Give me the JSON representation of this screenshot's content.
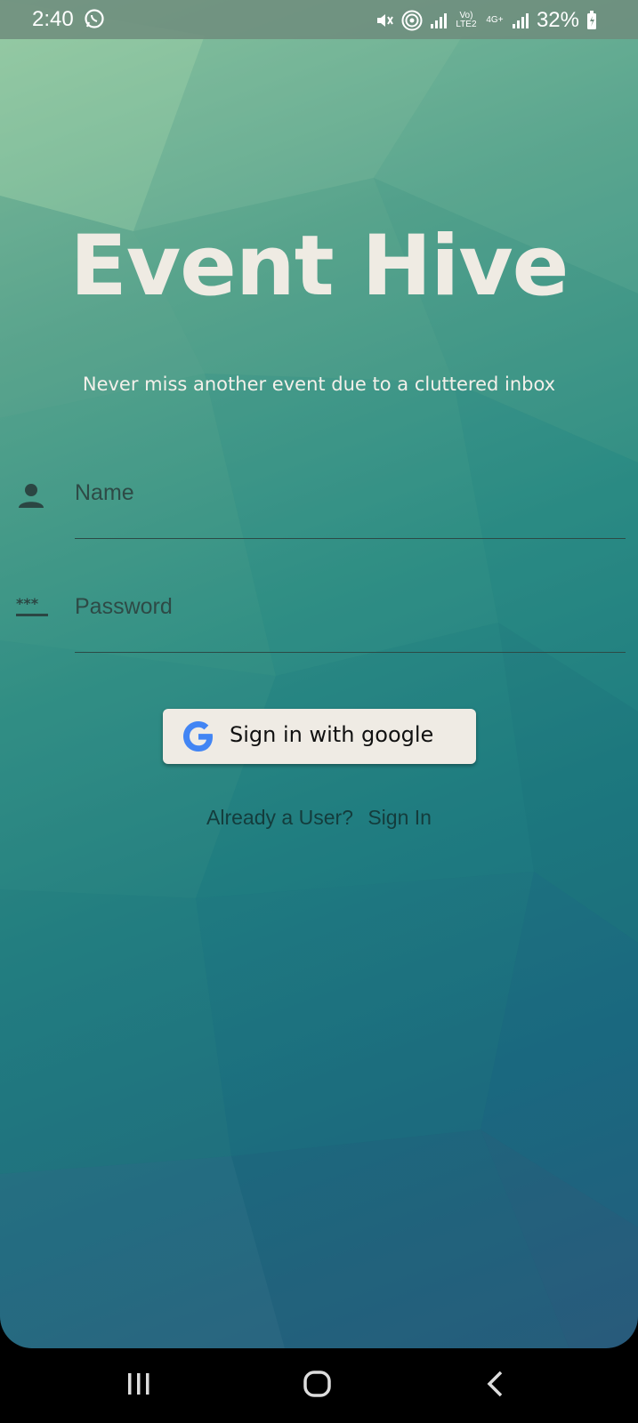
{
  "status_bar": {
    "time": "2:40",
    "battery": "32%",
    "network": "Vo) LTE2",
    "network_type": "4G+",
    "icons": [
      "whatsapp-icon",
      "mute-icon",
      "hotspot-icon",
      "signal-icon",
      "signal-icon",
      "battery-charging-icon"
    ]
  },
  "app": {
    "title": "Event Hive",
    "subtitle": "Never miss another event due to a cluttered inbox"
  },
  "form": {
    "name_placeholder": "Name",
    "password_placeholder": "Password",
    "password_icon_text": "***"
  },
  "google_button": {
    "label": "Sign in with google"
  },
  "footer": {
    "prompt": "Already a User?",
    "signin_link": "Sign In"
  },
  "colors": {
    "title": "#efebe3",
    "button_bg": "#efebe4",
    "accent_google_blue": "#4285f4"
  }
}
